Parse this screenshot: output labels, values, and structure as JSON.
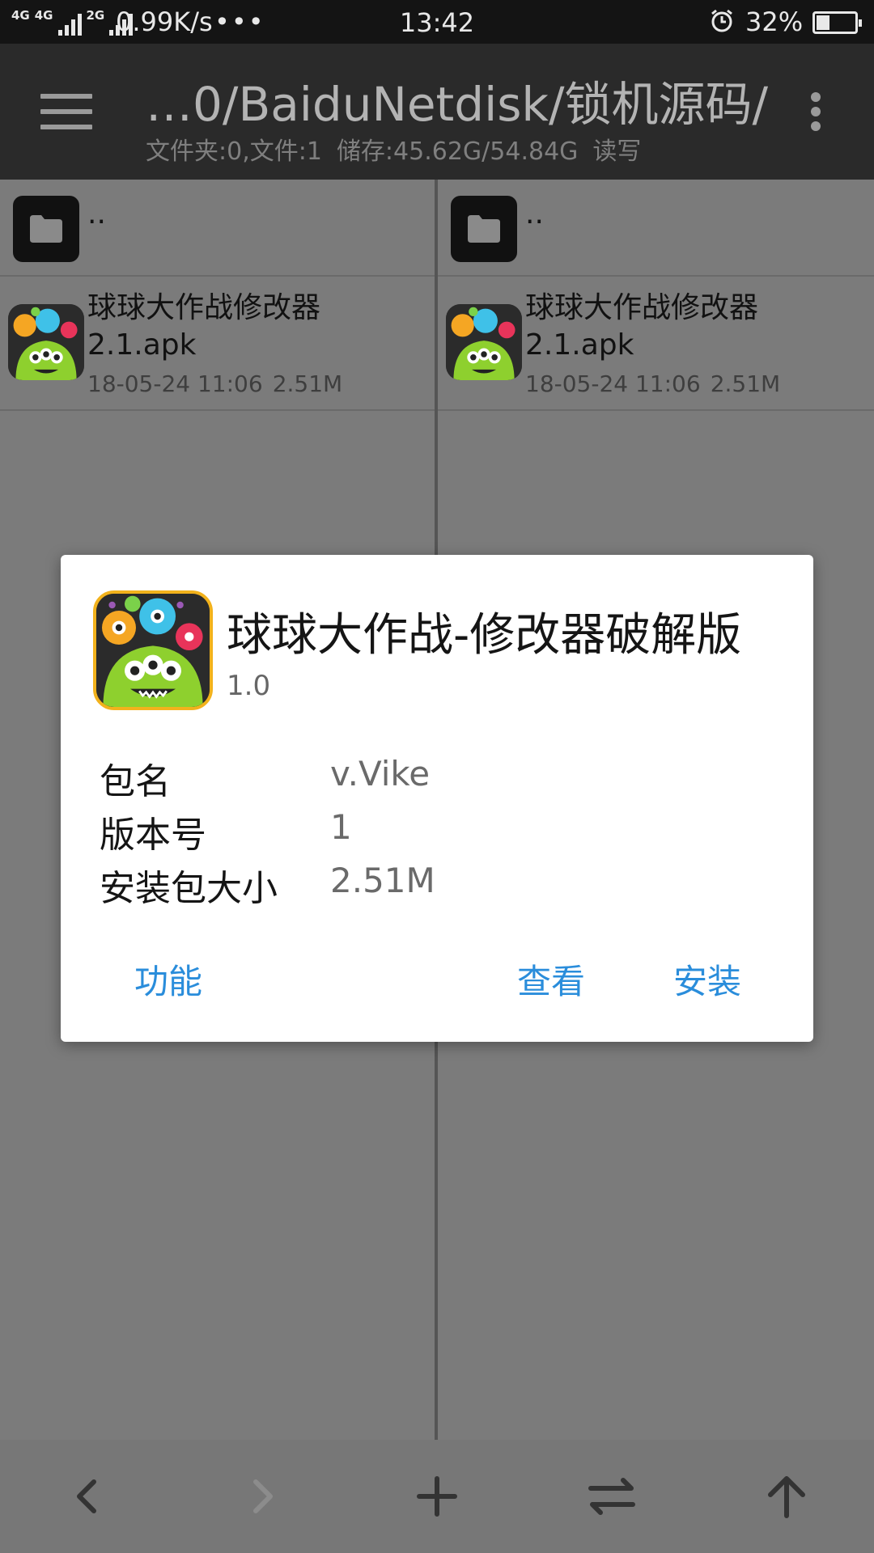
{
  "statusbar": {
    "net1": "4G",
    "net2": "4G",
    "net3": "2G",
    "speed": "0.99K/s",
    "dots": "•••",
    "time": "13:42",
    "battery_pct": "32%",
    "battery_level": 0.32
  },
  "toolbar": {
    "path": "…0/BaiduNetdisk/锁机源码/",
    "folders": "文件夹:0,文件:1",
    "storage": "储存:45.62G/54.84G",
    "mode": "读写"
  },
  "left_pane": {
    "up_label": "..",
    "file": {
      "name": "球球大作战修改器2.1.apk",
      "date": "18-05-24 11:06",
      "size": "2.51M"
    }
  },
  "right_pane": {
    "up_label": "..",
    "file": {
      "name": "球球大作战修改器2.1.apk",
      "date": "18-05-24 11:06",
      "size": "2.51M"
    }
  },
  "dialog": {
    "title": "球球大作战-修改器破解版",
    "version": "1.0",
    "rows": [
      {
        "label": "包名",
        "value": "v.Vike"
      },
      {
        "label": "版本号",
        "value": "1"
      },
      {
        "label": "安装包大小",
        "value": "2.51M"
      }
    ],
    "buttons": {
      "function": "功能",
      "view": "查看",
      "install": "安装"
    }
  },
  "bottombar": {
    "icons": [
      "back-arrow-icon",
      "forward-arrow-icon",
      "add-icon",
      "swap-icon",
      "up-arrow-icon"
    ]
  },
  "colors": {
    "accent": "#2a8ddb",
    "toolbar": "#2a2a2a",
    "statusbar": "#141414",
    "icon_border": "#f2b21c"
  }
}
